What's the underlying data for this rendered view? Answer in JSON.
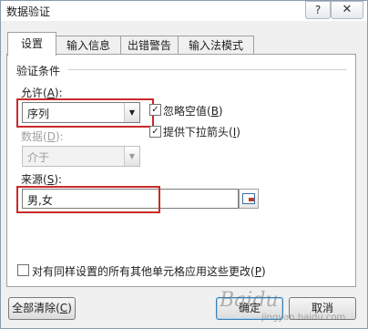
{
  "window": {
    "title": "数据验证",
    "help_label": "?",
    "close_label": "✕"
  },
  "tabs": [
    {
      "label": "设置",
      "active": true
    },
    {
      "label": "输入信息",
      "active": false
    },
    {
      "label": "出错警告",
      "active": false
    },
    {
      "label": "输入法模式",
      "active": false
    }
  ],
  "validation": {
    "group_title": "验证条件",
    "allow_label_prefix": "允许(",
    "allow_label_key": "A",
    "allow_label_suffix": "):",
    "allow_value": "序列",
    "ignore_blank_prefix": "忽略空值(",
    "ignore_blank_key": "B",
    "ignore_blank_suffix": ")",
    "ignore_blank_checked": true,
    "dropdown_prefix": "提供下拉箭头(",
    "dropdown_key": "I",
    "dropdown_suffix": ")",
    "dropdown_checked": true,
    "data_label_prefix": "数据(",
    "data_label_key": "D",
    "data_label_suffix": "):",
    "data_value": "介于",
    "source_label_prefix": "来源(",
    "source_label_key": "S",
    "source_label_suffix": "):",
    "source_value": "男,女"
  },
  "apply_all": {
    "prefix": "对有同样设置的所有其他单元格应用这些更改(",
    "key": "P",
    "suffix": ")",
    "checked": false
  },
  "buttons": {
    "clear_all_prefix": "全部清除(",
    "clear_all_key": "C",
    "clear_all_suffix": ")",
    "ok": "确定",
    "cancel": "取消"
  },
  "watermark": {
    "text": "Baidu",
    "sub": "jingyan.baidu.com"
  },
  "colors": {
    "highlight": "#c92a2a",
    "default_button": "#3c7fb1"
  }
}
